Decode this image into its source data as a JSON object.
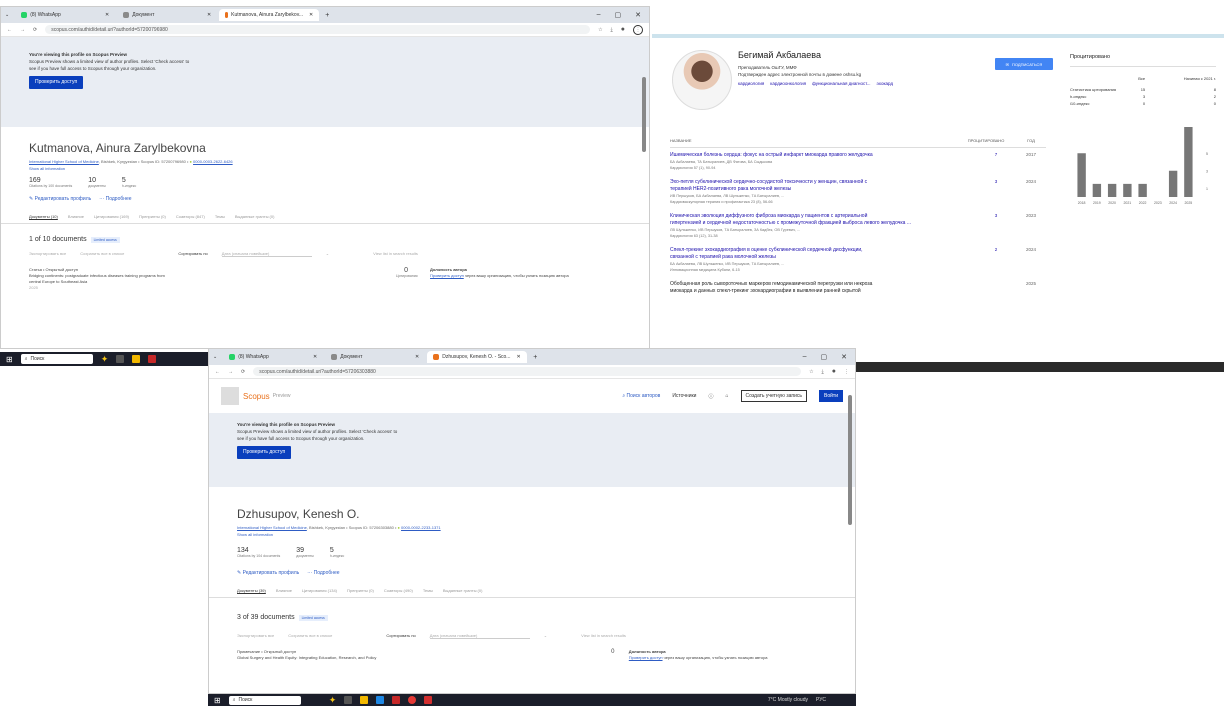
{
  "win1": {
    "tabs": [
      {
        "label": "(8) WhatsApp",
        "color": "#25d366"
      },
      {
        "label": "Документ",
        "color": "#8a8a8a"
      },
      {
        "label": "Kutmanova, Ainura Zarylbekov...",
        "color": "#e9711c"
      }
    ],
    "url": "scopus.com/authid/detail.uri?authorId=57200796980",
    "banner_title": "You're viewing this profile on Scopus Preview",
    "banner_text1": "Scopus Preview shows a limited view of author profiles. Select 'Check access' to",
    "banner_text2": "see if you have full access to Scopus through your organization.",
    "check_access": "Проверить доступ",
    "author_name": "Kutmanova, Ainura Zarylbekovna",
    "affil_link": "International Higher School of Medicine",
    "affil_text": ", Bishkek, Kyrgyzstan • Scopus ID: 57200796980 •",
    "orcid": "0000-0003-2622-6426",
    "show_all": "Show all information",
    "metrics": [
      {
        "n": "169",
        "l": "Citations by 100 documents"
      },
      {
        "n": "10",
        "l": "документы"
      },
      {
        "n": "5",
        "l": "h-индекс"
      }
    ],
    "edit_profile": "Редактировать профиль",
    "more": "Подробнее",
    "subtabs": [
      "Документы (10)",
      "Влияние",
      "Цитирования (169)",
      "Препринты (0)",
      "Соавторы (847)",
      "Темы",
      "Выданные гранты (0)"
    ],
    "docs_count": "1 of 10 documents",
    "limited": "Limited access",
    "export_all": "Экспортировать все",
    "save_list": "Сохранить все в списке",
    "sort_by": "Сортировать по",
    "sort_val": "Дата (сначала новейшие)",
    "view_list": "View list in search results",
    "doc_type": "Статья • Открытый доступ",
    "doc_title1": "Bridging continents: postgraduate infectious diseases training programs from",
    "doc_title2": "central Europe to Southeast Asia",
    "doc_cites": "0",
    "doc_cites_l": "Цитирования",
    "author_pos": "Должность автора",
    "author_pos_text": "Проверить доступ через вашу организацию, чтобы узнать позицию автора",
    "doc_year": "2025"
  },
  "taskbar1": {
    "search": "Поиск"
  },
  "win2": {
    "tabs": [
      {
        "label": "(8) WhatsApp",
        "color": "#25d366"
      },
      {
        "label": "Документ",
        "color": "#8a8a8a"
      },
      {
        "label": "Dzhusupov, Kenesh O. - Sco...",
        "color": "#e9711c"
      }
    ],
    "url": "scopus.com/authid/detail.uri?authorId=57206303880",
    "brand": "Scopus",
    "brand_sub": "Preview",
    "search_authors": "Поиск авторов",
    "sources": "Источники",
    "create_account": "Создать учетную запись",
    "login": "Войти",
    "banner_title": "You're viewing this profile on Scopus Preview",
    "banner_text1": "Scopus Preview shows a limited view of author profiles. Select 'Check access' to",
    "banner_text2": "see if you have full access to Scopus through your organization.",
    "check_access": "Проверить доступ",
    "author_name": "Dzhusupov, Kenesh O.",
    "affil_link": "International Higher School of Medicine",
    "affil_text": ", Bishkek, Kyrgyzstan • Scopus ID: 57206303880 •",
    "orcid": "0000-0002-2233-1371",
    "show_all": "Show all information",
    "metrics": [
      {
        "n": "134",
        "l": "Citations by 104 documents"
      },
      {
        "n": "39",
        "l": "документы"
      },
      {
        "n": "5",
        "l": "h-индекс"
      }
    ],
    "edit_profile": "Редактировать профиль",
    "more": "Подробнее",
    "subtabs": [
      "Документы (39)",
      "Влияние",
      "Цитирования (134)",
      "Препринты (0)",
      "Соавторы (490)",
      "Темы",
      "Выданные гранты (0)"
    ],
    "docs_count": "3 of 39 documents",
    "limited": "Limited access",
    "export_all": "Экспортировать все",
    "save_list": "Сохранить все в списке",
    "sort_by": "Сортировать по",
    "sort_val": "Дата (сначала новейшие)",
    "view_list": "View list in search results",
    "doc_type": "Примечание • Открытый доступ",
    "doc_title1": "Global Surgery and Health Equity: Integrating Education, Research, and Policy",
    "doc_cites": "0",
    "author_pos": "Должность автора",
    "author_pos_text": "Проверить доступ через вашу организацию, чтобы узнать позицию автора"
  },
  "taskbar2": {
    "search": "Поиск",
    "weather": "7°C  Mostly cloudy",
    "lang": "РУС"
  },
  "scholar": {
    "name": "Бегимай Акбалаева",
    "position": "Преподаватель ОшГУ, ММФ",
    "verified": "Подтвержден адрес электронной почты в домене oshsu.kg",
    "tags": [
      "кардиология",
      "кардиоонкология",
      "функциональная диагност...",
      "эхокард"
    ],
    "follow": "ПОДПИСАТЬСЯ",
    "col_title": "НАЗВАНИЕ",
    "col_cited": "ПРОЦИТИРОВАНО",
    "col_year": "ГОД",
    "articles": [
      {
        "t1": "Ишемическая болезнь сердца: фокус на острый инфаркт миокарда правого желудочка",
        "t2": "",
        "a": "БА Акбалаева, ТА Батыралиев, ДВ Фатова, БА Сыдыкова",
        "j": "Кардиология 57 (1), 90-94",
        "c": "7",
        "y": "2017"
      },
      {
        "t1": "Эхо-петля субклинической сердечно-сосудистой токсичности у женщин, связанной с",
        "t2": "терапией HER2-позитивного рака молочной железы",
        "a": "ИВ Першуков, БА Акбалаева, ЛВ Шульженко, ТА Батыралиев, ...",
        "j": "Кардиоваскулярная терапия и профилактика 23 (8), 56-66",
        "c": "3",
        "y": "2024"
      },
      {
        "t1": "Клиническая эволюция диффузного фиброза миокарда у пациентов с артериальной",
        "t2": "гипертензией и сердечной недостаточностью с промежуточной фракцией выброса левого желудочка ...",
        "a": "ЛВ Шульженко, ИВ Першуков, ТА Батыралиев, ЗА Кадбек, ОВ Гуревич, ...",
        "j": "Кардиология 63 (12), 31-38",
        "c": "3",
        "y": "2023"
      },
      {
        "t1": "Спекл-трекинг эхокардиография в оценке субклинической сердечной дисфункции,",
        "t2": "связанной с терапией рака молочной железы",
        "a": "БА Акбалаева, ЛВ Шульженко, ИВ Першуков, ТА Батыралиев, ...",
        "j": "Инновационная медицина Кубани, 6-15",
        "c": "2",
        "y": "2024"
      },
      {
        "t1": "Обобщенная роль сывороточных маркеров гемодинамической перегрузки или некроза",
        "t2": "миокарда и данных спекл-трекинг эхокардиографии в выявлении ранней скрытой",
        "a": "",
        "j": "",
        "c": "",
        "y": "2025"
      }
    ],
    "cited_title": "Процитировано",
    "cited_all": "Все",
    "cited_since": "Начиная с 2021 г.",
    "cited_rows": [
      {
        "k": "Статистика цитирования",
        "v1": "15",
        "v2": "8"
      },
      {
        "k": "h-индекс",
        "v1": "3",
        "v2": "2"
      },
      {
        "k": "i10-индекс",
        "v1": "0",
        "v2": "0"
      }
    ]
  },
  "chart_data": {
    "type": "bar",
    "categories": [
      "2018",
      "2019",
      "2020",
      "2021",
      "2022",
      "2023",
      "2024",
      "2025"
    ],
    "values": [
      5,
      1.5,
      1.5,
      1.5,
      1.5,
      0,
      3,
      8
    ],
    "ylim": [
      0,
      8
    ],
    "yticks": [
      "1",
      "3",
      "5"
    ]
  },
  "colors": {
    "scopus_blue": "#0a3fbd",
    "scholar_blue": "#4285f4",
    "bar": "#777777",
    "taskbar": "#1b1e2a"
  }
}
